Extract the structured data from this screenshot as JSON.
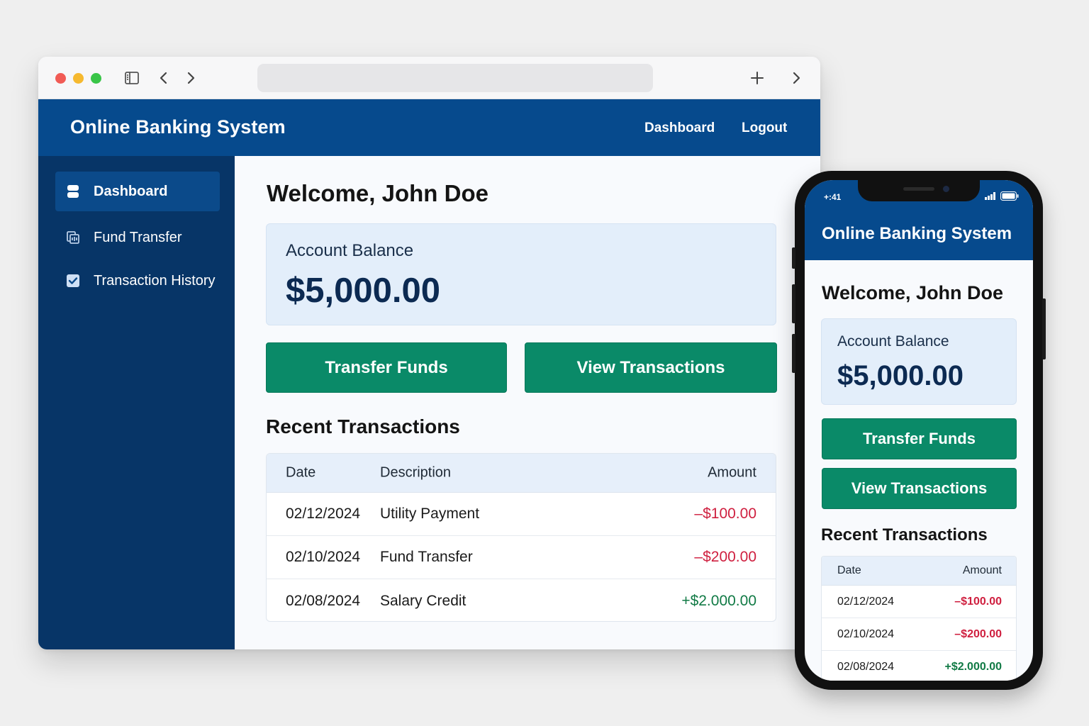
{
  "colors": {
    "brand_blue": "#064a8d",
    "sidebar_blue": "#073567",
    "button_green": "#0a8a68",
    "negative_red": "#cf1f3f",
    "positive_green": "#117a45",
    "card_bg": "#e3eefa"
  },
  "browser": {
    "icons": [
      "sidebar-toggle-icon",
      "back-arrow-icon",
      "forward-arrow-icon",
      "new-tab-plus-icon",
      "chevron-right-icon"
    ]
  },
  "header": {
    "title": "Online Banking System",
    "nav": {
      "dashboard": "Dashboard",
      "logout": "Logout"
    }
  },
  "sidebar": {
    "items": [
      {
        "label": "Dashboard",
        "icon": "dashboard-icon",
        "active": true
      },
      {
        "label": "Fund Transfer",
        "icon": "transfer-icon",
        "active": false
      },
      {
        "label": "Transaction History",
        "icon": "checkbox-icon",
        "active": false
      }
    ]
  },
  "main": {
    "welcome": "Welcome, John Doe",
    "balance": {
      "label": "Account Balance",
      "value": "$5,000.00"
    },
    "buttons": {
      "transfer": "Transfer Funds",
      "view": "View Transactions"
    },
    "recent_title": "Recent Transactions",
    "table": {
      "headers": {
        "date": "Date",
        "description": "Description",
        "amount": "Amount"
      },
      "rows": [
        {
          "date": "02/12/2024",
          "description": "Utility Payment",
          "amount": "–$100.00",
          "type": "negative"
        },
        {
          "date": "02/10/2024",
          "description": "Fund Transfer",
          "amount": "–$200.00",
          "type": "negative"
        },
        {
          "date": "02/08/2024",
          "description": "Salary Credit",
          "amount": "+$2.000.00",
          "type": "positive"
        }
      ]
    }
  },
  "mobile": {
    "status_time": "+:41",
    "title": "Online Banking System",
    "welcome": "Welcome, John Doe",
    "balance": {
      "label": "Account Balance",
      "value": "$5,000.00"
    },
    "buttons": {
      "transfer": "Transfer Funds",
      "view": "View Transactions"
    },
    "recent_title": "Recent Transactions",
    "table": {
      "headers": {
        "date": "Date",
        "amount": "Amount"
      },
      "rows": [
        {
          "date": "02/12/2024",
          "amount": "–$100.00",
          "type": "negative"
        },
        {
          "date": "02/10/2024",
          "amount": "–$200.00",
          "type": "negative"
        },
        {
          "date": "02/08/2024",
          "amount": "+$2.000.00",
          "type": "positive"
        }
      ]
    }
  }
}
